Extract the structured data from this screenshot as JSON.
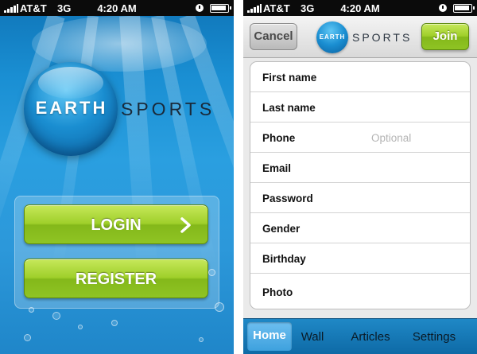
{
  "status_bar": {
    "carrier": "AT&T",
    "network": "3G",
    "time": "4:20 AM"
  },
  "welcome": {
    "logo_earth": "EARTH",
    "logo_sports": "SPORTS",
    "login_label": "LOGIN",
    "register_label": "REGISTER"
  },
  "register": {
    "cancel_label": "Cancel",
    "join_label": "Join",
    "logo_earth": "EARTH",
    "logo_sports": "SPORTS",
    "fields": [
      {
        "label": "First name",
        "placeholder": ""
      },
      {
        "label": "Last name",
        "placeholder": ""
      },
      {
        "label": "Phone",
        "placeholder": "Optional"
      },
      {
        "label": "Email",
        "placeholder": ""
      },
      {
        "label": "Password",
        "placeholder": ""
      },
      {
        "label": "Gender",
        "placeholder": ""
      },
      {
        "label": "Birthday",
        "placeholder": ""
      },
      {
        "label": "Photo",
        "placeholder": ""
      }
    ]
  },
  "tabs": [
    {
      "label": "Home",
      "active": true
    },
    {
      "label": "Wall",
      "active": false
    },
    {
      "label": "Articles",
      "active": false
    },
    {
      "label": "Settings",
      "active": false
    }
  ],
  "colors": {
    "accent_green": "#9fcf2a",
    "ocean_blue": "#1a8fd3",
    "tab_blue": "#0e6aa6"
  },
  "icons": [
    "signal-icon",
    "lock-rotation-icon",
    "battery-icon",
    "chevron-right-icon"
  ]
}
